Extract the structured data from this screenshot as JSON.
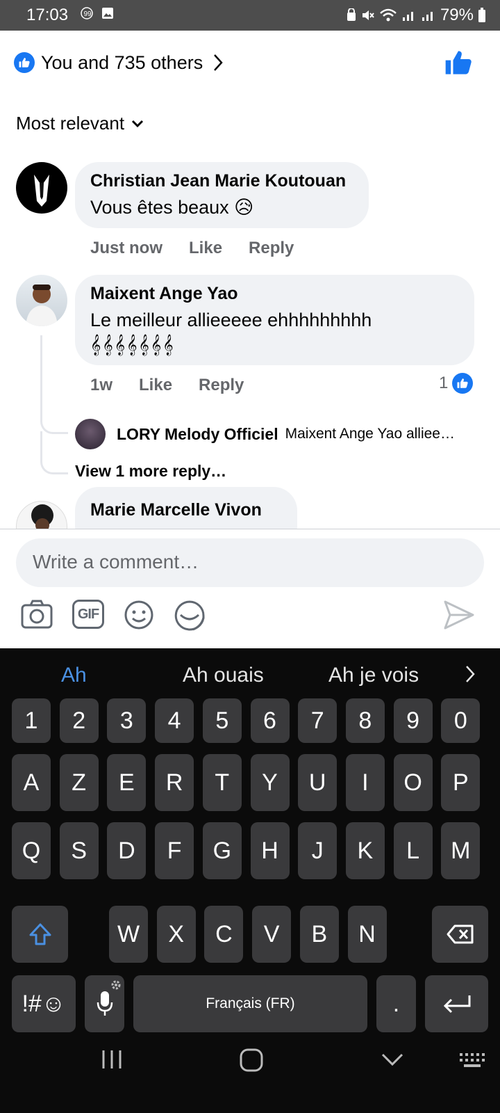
{
  "status_bar": {
    "time": "17:03",
    "battery": "79%"
  },
  "reactions": {
    "summary": "You and 735 others"
  },
  "sort": {
    "label": "Most relevant"
  },
  "comments": [
    {
      "author": "Christian Jean Marie Koutouan",
      "text": "Vous êtes beaux 😥",
      "time": "Just now",
      "like": "Like",
      "reply": "Reply"
    },
    {
      "author": "Maixent Ange Yao",
      "text": "Le meilleur allieeeee ehhhhhhhhh",
      "music": "𝄞𝄞𝄞𝄞𝄞𝄞𝄞",
      "time": "1w",
      "like": "Like",
      "reply": "Reply",
      "likes_count": "1"
    }
  ],
  "reply_preview": {
    "author": "LORY Melody Officiel",
    "text": "Maixent Ange Yao alliee…"
  },
  "view_more": "View 1 more reply…",
  "partial_comment": {
    "author": "Marie Marcelle Vivon"
  },
  "composer": {
    "placeholder": "Write a comment…"
  },
  "composer_tools": {
    "gif": "GIF"
  },
  "keyboard": {
    "suggestions": [
      "Ah",
      "Ah ouais",
      "Ah je vois"
    ],
    "row_numbers": [
      "1",
      "2",
      "3",
      "4",
      "5",
      "6",
      "7",
      "8",
      "9",
      "0"
    ],
    "row1": [
      "A",
      "Z",
      "E",
      "R",
      "T",
      "Y",
      "U",
      "I",
      "O",
      "P"
    ],
    "row2": [
      "Q",
      "S",
      "D",
      "F",
      "G",
      "H",
      "J",
      "K",
      "L",
      "M"
    ],
    "row3": [
      "W",
      "X",
      "C",
      "V",
      "B",
      "N"
    ],
    "symbols": "!#☺",
    "space": "Français (FR)",
    "period": "."
  },
  "colors": {
    "brand": "#1877f2",
    "bubble": "#f0f2f5",
    "meta": "#65676b",
    "keyboard_bg": "#0b0b0b",
    "key_bg": "#3a3a3c"
  },
  "icons": [
    "like-icon",
    "chevron-right-icon",
    "chevron-down-icon",
    "camera-icon",
    "gif-icon",
    "smiley-icon",
    "sticker-icon",
    "send-icon",
    "shift-icon",
    "backspace-icon",
    "mic-icon",
    "enter-icon"
  ]
}
